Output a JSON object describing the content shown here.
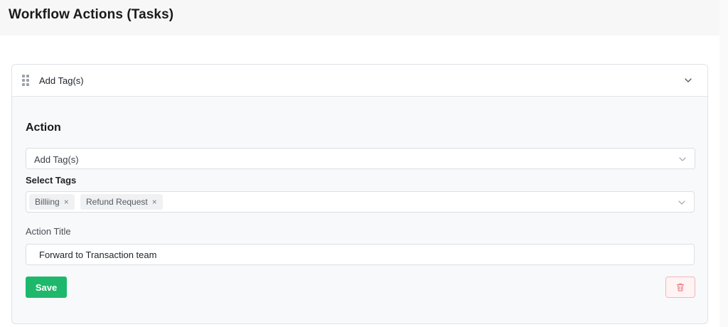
{
  "header": {
    "title": "Workflow Actions (Tasks)"
  },
  "card": {
    "header_title": "Add Tag(s)",
    "section_title": "Action",
    "action_select": {
      "value": "Add Tag(s)"
    },
    "tags_field": {
      "label": "Select Tags",
      "tags": [
        {
          "label": "Billiing",
          "remove": "×"
        },
        {
          "label": "Refund Request",
          "remove": "×"
        }
      ]
    },
    "title_field": {
      "label": "Action Title",
      "value": "Forward to Transaction team"
    },
    "save_label": "Save"
  },
  "colors": {
    "save": "#1db86b",
    "delete_border": "#f2b8b8",
    "delete_icon": "#e8838a"
  }
}
